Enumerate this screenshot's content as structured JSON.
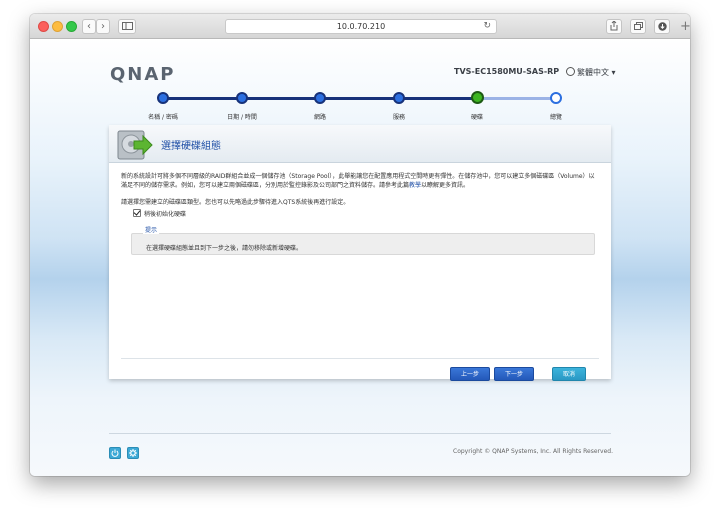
{
  "browser": {
    "url": "10.0.70.210",
    "back_icon": "chevron-left-icon",
    "forward_icon": "chevron-right-icon",
    "sidebar_icon": "sidebar-icon",
    "reload_icon": "reload-icon",
    "share_icon": "share-icon",
    "tabs_icon": "tabs-icon",
    "download_icon": "download-icon",
    "new_tab_label": "+"
  },
  "header": {
    "logo": "QNAP",
    "model": "TVS-EC1580MU-SAS-RP",
    "language": "繁體中文"
  },
  "wizard": {
    "steps": [
      {
        "label": "名稱 / 密碼"
      },
      {
        "label": "日期 / 時間"
      },
      {
        "label": "網路"
      },
      {
        "label": "服務"
      },
      {
        "label": "硬碟"
      },
      {
        "label": "總覽"
      }
    ],
    "current_step_index": 4
  },
  "panel": {
    "title": "選擇硬碟組態",
    "description_part1": "新的系統設計可將多個不同層級的RAID群組合並成一個儲存池（Storage Pool），此舉能讓您在配置應用程式空間時更有彈性。在儲存池中，您可以建立多個磁碟區（Volume）以滿足不同的儲存需求。例如，您可以建立兩個磁碟區，分別用於監控錄影及公司部門之資料儲存。請參考此篇",
    "description_link": "教學",
    "description_part2": "以瞭解更多資訊。",
    "prompt": "請選擇您需建立的磁碟區類型。您也可以先略過此步驟待進入QTS系統後再進行設定。",
    "checkbox_label": "稍後初始化硬碟",
    "checkbox_checked": true,
    "tip_legend": "提示",
    "tip_text": "在選擇硬碟組態並且到下一步之後，請勿移除或新增硬碟。"
  },
  "buttons": {
    "prev": "上一步",
    "next": "下一步",
    "cancel": "取消"
  },
  "footer": {
    "power_icon": "power-icon",
    "settings_icon": "gear-icon",
    "copyright": "Copyright © QNAP Systems, Inc. All Rights Reserved."
  }
}
